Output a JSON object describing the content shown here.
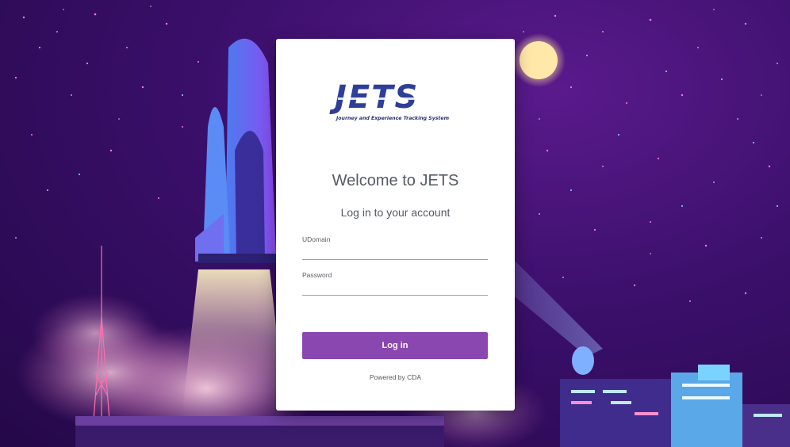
{
  "logo": {
    "mark": "JETS",
    "tagline": "Journey and Experience Tracking System"
  },
  "login": {
    "title": "Welcome to JETS",
    "subtitle": "Log in to your account",
    "udomain_label": "UDomain",
    "password_label": "Password",
    "button_label": "Log in",
    "footer": "Powered by CDA"
  },
  "colors": {
    "accent": "#8a47b0",
    "logo_blue": "#2e3f98",
    "background": "#3a0f6a"
  }
}
